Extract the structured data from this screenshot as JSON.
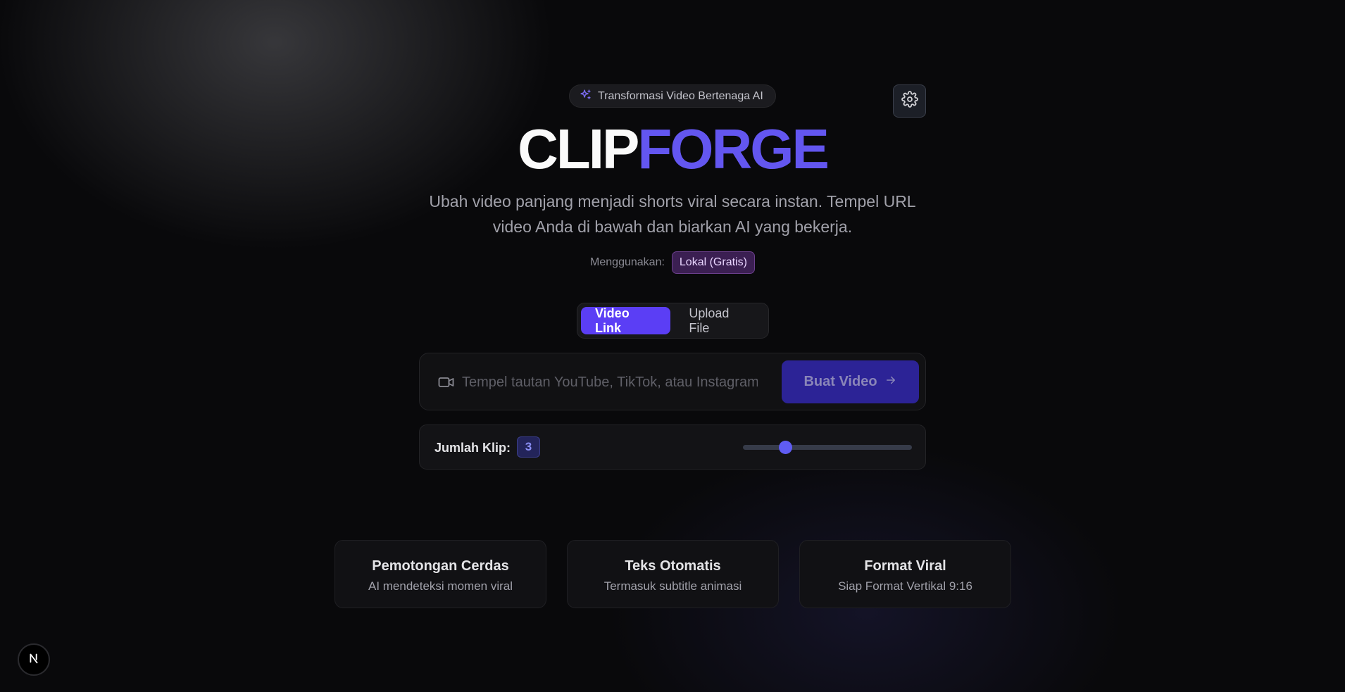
{
  "header": {
    "badge": "Transformasi Video Bertenaga AI",
    "title_part1": "CLIP",
    "title_part2": "FORGE",
    "subtitle": "Ubah video panjang menjadi shorts viral secara instan. Tempel URL video Anda di bawah dan biarkan AI yang bekerja.",
    "using_label": "Menggunakan:",
    "using_value": "Lokal (Gratis)"
  },
  "icons": {
    "badge": "sparkles-icon",
    "settings": "gear-icon",
    "url": "video-camera-icon",
    "button": "arrow-right-icon",
    "framework": "nextjs-logo-icon"
  },
  "tabs": [
    {
      "label": "Video Link",
      "active": true
    },
    {
      "label": "Upload File",
      "active": false
    }
  ],
  "url_input": {
    "value": "",
    "placeholder": "Tempel tautan YouTube, TikTok, atau Instagram..."
  },
  "create_button": {
    "label": "Buat Video"
  },
  "clips": {
    "label": "Jumlah Klip:",
    "count": "3",
    "slider_fraction": 0.25
  },
  "features": [
    {
      "title": "Pemotongan Cerdas",
      "desc": "AI mendeteksi momen viral"
    },
    {
      "title": "Teks Otomatis",
      "desc": "Termasuk subtitle animasi"
    },
    {
      "title": "Format Viral",
      "desc": "Siap Format Vertikal 9:16"
    }
  ],
  "colors": {
    "accent": "#5b3ef5",
    "brand_forge": "#6356f0",
    "background": "#09090b",
    "pill_purple": "#3b1f52"
  }
}
